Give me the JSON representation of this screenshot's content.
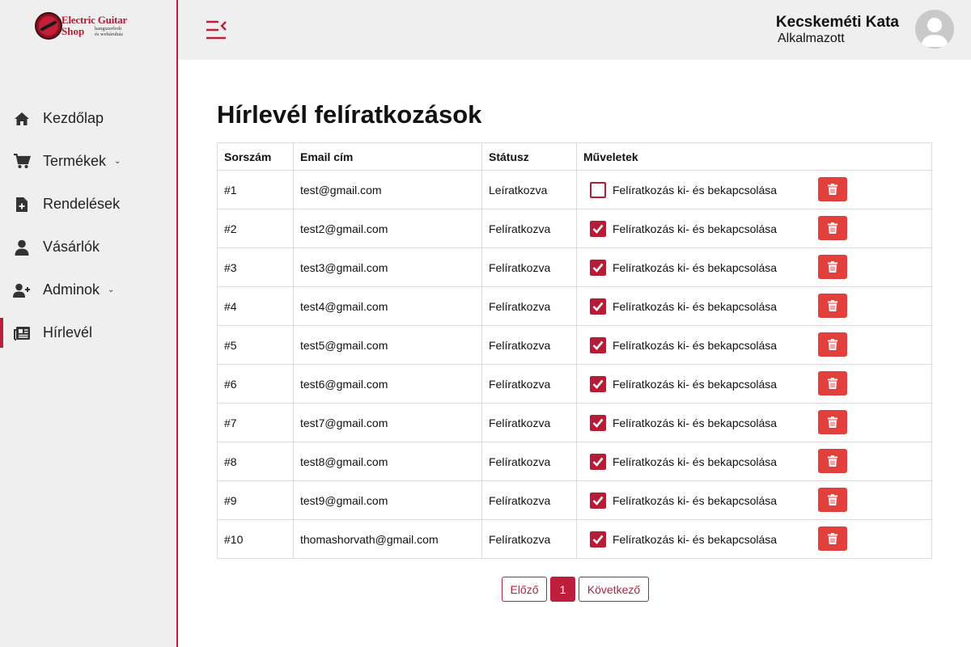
{
  "colors": {
    "accent": "#be1e3c",
    "unsubscribed": "#d3172b",
    "subscribed": "#168a1f",
    "delete": "#e2403d"
  },
  "logo": {
    "line1": "Electric Guitar",
    "line2": "Shop",
    "sub1": "hangszerbolt",
    "sub2": "és webáruház"
  },
  "sidebar": {
    "items": [
      {
        "label": "Kezdőlap",
        "icon": "home-icon"
      },
      {
        "label": "Termékek",
        "icon": "cart-icon",
        "caret": "⌄"
      },
      {
        "label": "Rendelések",
        "icon": "file-plus-icon"
      },
      {
        "label": "Vásárlók",
        "icon": "user-icon"
      },
      {
        "label": "Adminok",
        "icon": "user-plus-icon",
        "caret": "⌄"
      },
      {
        "label": "Hírlevél",
        "icon": "newspaper-icon"
      }
    ]
  },
  "header": {
    "user_name": "Kecskeméti Kata",
    "user_role": "Alkalmazott"
  },
  "main": {
    "title": "Hírlevél felíratkozások",
    "columns": [
      "Sorszám",
      "Email cím",
      "Státusz",
      "Műveletek"
    ],
    "toggle_label": "Felíratkozás ki- és bekapcsolása",
    "rows": [
      {
        "id": "#1",
        "email": "test@gmail.com",
        "status": "Leíratkozva",
        "subscribed": false
      },
      {
        "id": "#2",
        "email": "test2@gmail.com",
        "status": "Felíratkozva",
        "subscribed": true
      },
      {
        "id": "#3",
        "email": "test3@gmail.com",
        "status": "Felíratkozva",
        "subscribed": true
      },
      {
        "id": "#4",
        "email": "test4@gmail.com",
        "status": "Felíratkozva",
        "subscribed": true
      },
      {
        "id": "#5",
        "email": "test5@gmail.com",
        "status": "Felíratkozva",
        "subscribed": true
      },
      {
        "id": "#6",
        "email": "test6@gmail.com",
        "status": "Felíratkozva",
        "subscribed": true
      },
      {
        "id": "#7",
        "email": "test7@gmail.com",
        "status": "Felíratkozva",
        "subscribed": true
      },
      {
        "id": "#8",
        "email": "test8@gmail.com",
        "status": "Felíratkozva",
        "subscribed": true
      },
      {
        "id": "#9",
        "email": "test9@gmail.com",
        "status": "Felíratkozva",
        "subscribed": true
      },
      {
        "id": "#10",
        "email": "thomashorvath@gmail.com",
        "status": "Felíratkozva",
        "subscribed": true
      }
    ]
  },
  "pagination": {
    "prev": "Előző",
    "current": "1",
    "next": "Következő"
  }
}
